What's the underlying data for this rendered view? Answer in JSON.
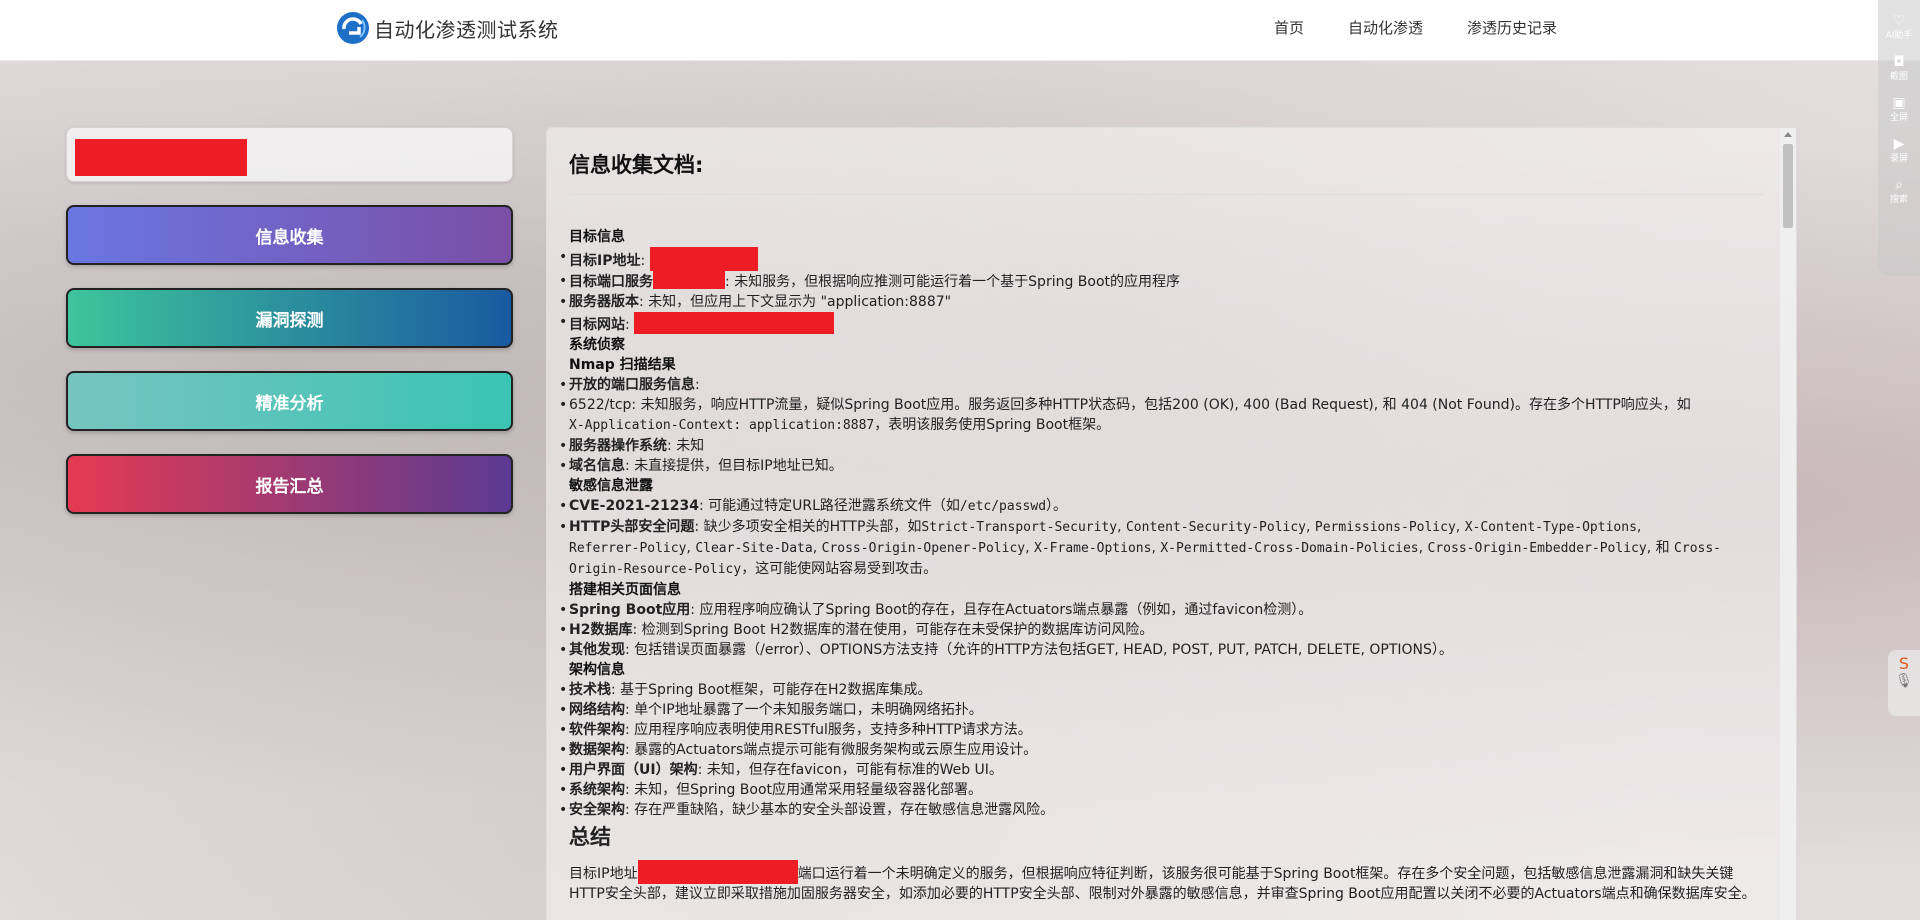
{
  "header": {
    "title": "自动化渗透测试系统",
    "nav": [
      "首页",
      "自动化渗透",
      "渗透历史记录"
    ]
  },
  "browser_toolbar": {
    "items": [
      {
        "icon": "ai-icon",
        "label": "AI助手"
      },
      {
        "icon": "screenshot-icon",
        "label": "截图"
      },
      {
        "icon": "fullscreen-icon",
        "label": "全屏"
      },
      {
        "icon": "record-icon",
        "label": "录屏"
      },
      {
        "icon": "search-icon",
        "label": "搜索"
      }
    ]
  },
  "sidebar": {
    "buttons": [
      "信息收集",
      "漏洞探测",
      "精准分析",
      "报告汇总"
    ]
  },
  "doc": {
    "title": "信息收集文档:",
    "sec_target": "目标信息",
    "t1_label": "目标IP地址",
    "t2_label": "目标端口服务",
    "t2_text": ": 未知服务，但根据响应推测可能运行着一个基于Spring Boot的应用程序",
    "t3_label": "服务器版本",
    "t3_text": ": 未知，但应用上下文显示为 \"application:8887\"",
    "t4_label": "目标网站",
    "sec_recon": "系统侦察",
    "sec_nmap": "Nmap 扫描结果",
    "n1_label": "开放的端口服务信息",
    "n2_text": "6522/tcp: 未知服务，响应HTTP流量，疑似Spring Boot应用。服务返回多种HTTP状态码，包括200 (OK), 400 (Bad Request), 和 404 (Not Found)。存在多个HTTP响应头，如",
    "n2_mono": "X-Application-Context: application:8887",
    "n2_tail": "，表明该服务使用Spring Boot框架。",
    "n3_label": "服务器操作系统",
    "n3_text": ": 未知",
    "n4_label": "域名信息",
    "n4_text": ": 未直接提供，但目标IP地址已知。",
    "sec_leak": "敏感信息泄露",
    "l1_label": "CVE-2021-21234",
    "l1_text": ": 可能通过特定URL路径泄露系统文件（如",
    "l1_mono": "/etc/passwd",
    "l1_tail": "）。",
    "l2_label": "HTTP头部安全问题",
    "l2_text": ": 缺少多项安全相关的HTTP头部，如",
    "l2_mono1": "Strict-Transport-Security",
    "l2_mono2": "Content-Security-Policy",
    "l2_mono3": "Permissions-Policy",
    "l2_mono4": "X-Content-Type-Options",
    "l2_mono5": "Referrer-Policy",
    "l2_mono6": "Clear-Site-Data",
    "l2_mono7": "Cross-Origin-Opener-Policy",
    "l2_mono8": "X-Frame-Options",
    "l2_mono9": "X-Permitted-Cross-Domain-Policies",
    "l2_mono10": "Cross-Origin-Embedder-Policy",
    "l2_and": "和",
    "l2_mono11": "Cross-Origin-Resource-Policy",
    "l2_tail": "，这可能使网站容易受到攻击。",
    "sec_pages": "搭建相关页面信息",
    "p1_label": "Spring Boot应用",
    "p1_text": ": 应用程序响应确认了Spring Boot的存在，且存在Actuators端点暴露（例如，通过favicon检测）。",
    "p2_label": "H2数据库",
    "p2_text": ": 检测到Spring Boot H2数据库的潜在使用，可能存在未受保护的数据库访问风险。",
    "p3_label": "其他发现",
    "p3_text": ": 包括错误页面暴露（/error）、OPTIONS方法支持（允许的HTTP方法包括GET, HEAD, POST, PUT, PATCH, DELETE, OPTIONS）。",
    "sec_arch": "架构信息",
    "a1_label": "技术栈",
    "a1_text": ": 基于Spring Boot框架，可能存在H2数据库集成。",
    "a2_label": "网络结构",
    "a2_text": ": 单个IP地址暴露了一个未知服务端口，未明确网络拓扑。",
    "a3_label": "软件架构",
    "a3_text": ": 应用程序响应表明使用RESTful服务，支持多种HTTP请求方法。",
    "a4_label": "数据架构",
    "a4_text": ": 暴露的Actuators端点提示可能有微服务架构或云原生应用设计。",
    "a5_label": "用户界面（UI）架构",
    "a5_text": ": 未知，但存在favicon，可能有标准的Web UI。",
    "a6_label": "系统架构",
    "a6_text": ": 未知，但Spring Boot应用通常采用轻量级容器化部署。",
    "a7_label": "安全架构",
    "a7_text": ": 存在严重缺陷，缺少基本的安全头部设置，存在敏感信息泄露风险。",
    "summary_title": "总结",
    "summary_pre": "目标IP地址",
    "summary_text": "端口运行着一个未明确定义的服务，但根据响应特征判断，该服务很可能基于Spring Boot框架。存在多个安全问题，包括敏感信息泄露漏洞和缺失关键HTTP安全头部，建议立即采取措施加固服务器安全，如添加必要的HTTP安全头部、限制对外暴露的敏感信息，并审查Spring Boot应用配置以关闭不必要的Actuators端点和确保数据库安全。"
  },
  "colors": {
    "redaction": "#ee1c25"
  }
}
